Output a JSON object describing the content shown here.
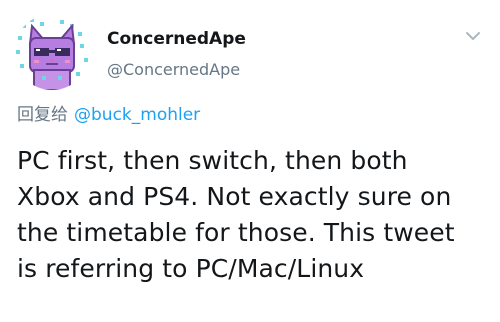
{
  "author": {
    "display_name": "ConcernedApe",
    "handle": "@ConcernedApe",
    "avatar_icon": "purple-pixel-cat-with-sunglasses-avatar"
  },
  "menu": {
    "icon": "chevron-down-icon"
  },
  "reply": {
    "prefix": "回复给",
    "mention": "@buck_mohler"
  },
  "tweet": {
    "lines": [
      "PC first, then switch, then both",
      "Xbox and PS4. Not exactly sure on",
      "the timetable for those. This tweet",
      "is referring to PC/Mac/Linux"
    ]
  },
  "colors": {
    "text": "#14171a",
    "secondary": "#657786",
    "link": "#1da1f2",
    "background": "#ffffff",
    "avatar_purple": "#b57ee0",
    "avatar_cyan": "#6fd6e8"
  }
}
